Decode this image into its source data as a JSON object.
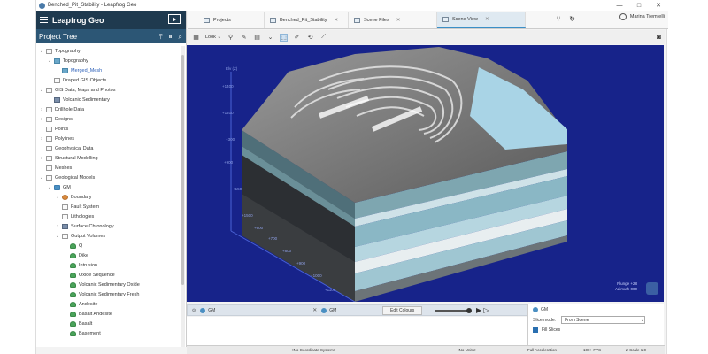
{
  "window": {
    "title": "Benched_Pit_Stability - Leapfrog Geo",
    "controls": [
      "—",
      "□",
      "✕"
    ]
  },
  "sidebar": {
    "brand": "Leapfrog Geo",
    "panel_title": "Project Tree",
    "tree": [
      {
        "label": "Topography",
        "depth": 0,
        "expander": "open",
        "icon": "folder-icon"
      },
      {
        "label": "Topography",
        "depth": 1,
        "expander": "open",
        "icon": "topography-icon"
      },
      {
        "label": "Merged_Mesh",
        "depth": 2,
        "expander": "",
        "icon": "mesh-icon",
        "selected": true
      },
      {
        "label": "Draped GIS Objects",
        "depth": 1,
        "expander": "",
        "icon": "folder-icon"
      },
      {
        "label": "GIS Data, Maps and Photos",
        "depth": 0,
        "expander": "open",
        "icon": "folder-icon"
      },
      {
        "label": "Volcanic Sedimentary",
        "depth": 1,
        "expander": "",
        "icon": "map-icon"
      },
      {
        "label": "Drillhole Data",
        "depth": 0,
        "expander": "closed",
        "icon": "folder-icon"
      },
      {
        "label": "Designs",
        "depth": 0,
        "expander": "closed",
        "icon": "folder-icon"
      },
      {
        "label": "Points",
        "depth": 0,
        "expander": "",
        "icon": "folder-icon"
      },
      {
        "label": "Polylines",
        "depth": 0,
        "expander": "closed",
        "icon": "folder-icon"
      },
      {
        "label": "Geophysical Data",
        "depth": 0,
        "expander": "",
        "icon": "folder-icon"
      },
      {
        "label": "Structural Modelling",
        "depth": 0,
        "expander": "closed",
        "icon": "folder-icon"
      },
      {
        "label": "Meshes",
        "depth": 0,
        "expander": "",
        "icon": "folder-icon"
      },
      {
        "label": "Geological Models",
        "depth": 0,
        "expander": "open",
        "icon": "folder-icon"
      },
      {
        "label": "GM",
        "depth": 1,
        "expander": "open",
        "icon": "geological-model-icon"
      },
      {
        "label": "Boundary",
        "depth": 2,
        "expander": "closed",
        "icon": "boundary-icon"
      },
      {
        "label": "Fault System",
        "depth": 2,
        "expander": "",
        "icon": "folder-icon"
      },
      {
        "label": "Lithologies",
        "depth": 2,
        "expander": "",
        "icon": "folder-icon"
      },
      {
        "label": "Surface Chronology",
        "depth": 2,
        "expander": "closed",
        "icon": "chronology-icon"
      },
      {
        "label": "Output Volumes",
        "depth": 2,
        "expander": "open",
        "icon": "folder-icon"
      },
      {
        "label": "Q",
        "depth": 3,
        "expander": "",
        "icon": "volume-icon"
      },
      {
        "label": "Dike",
        "depth": 3,
        "expander": "",
        "icon": "volume-icon"
      },
      {
        "label": "Intrusion",
        "depth": 3,
        "expander": "",
        "icon": "volume-icon"
      },
      {
        "label": "Oxide Sequence",
        "depth": 3,
        "expander": "",
        "icon": "volume-icon"
      },
      {
        "label": "Volcanic Sedimentary Oxide",
        "depth": 3,
        "expander": "",
        "icon": "volume-icon"
      },
      {
        "label": "Volcanic Sedimentary Fresh",
        "depth": 3,
        "expander": "",
        "icon": "volume-icon"
      },
      {
        "label": "Andesite",
        "depth": 3,
        "expander": "",
        "icon": "volume-icon"
      },
      {
        "label": "Basalt Andesite",
        "depth": 3,
        "expander": "",
        "icon": "volume-icon"
      },
      {
        "label": "Basalt",
        "depth": 3,
        "expander": "",
        "icon": "volume-icon"
      },
      {
        "label": "Basement",
        "depth": 3,
        "expander": "",
        "icon": "volume-icon"
      }
    ]
  },
  "tabs": [
    {
      "label": "Projects",
      "active": false,
      "closable": false
    },
    {
      "label": "Benched_Pit_Stability",
      "active": false,
      "closable": true
    },
    {
      "label": "Scene Files",
      "active": false,
      "closable": true
    },
    {
      "label": "Scene View",
      "active": true,
      "closable": true
    }
  ],
  "user": {
    "name": "Marina Tremtelli"
  },
  "toolbar": {
    "look_label": "Look"
  },
  "viewport": {
    "axis_labels": [
      "Elv (Z)",
      "+1400",
      "+1400",
      "+900",
      "+300",
      "+150",
      "+1500",
      "+600",
      "+700",
      "+800",
      "+900",
      "+1000",
      "+1100"
    ],
    "plunge_text": "Plunge +28",
    "azimuth_text": "Azimuth 000"
  },
  "shape_list": {
    "left_item": "GM",
    "right_item": "GM",
    "edit_colours": "Edit Colours"
  },
  "slice_panel": {
    "object": "GM",
    "mode_label": "Slice mode:",
    "mode_value": "From Scene",
    "fill_slices": "Fill Slices"
  },
  "statusbar": {
    "coordinate_system": "<No Coordinate System>",
    "units": "<No Units>",
    "acceleration": "Full Acceleration",
    "fps": "100+ FPS",
    "zscale": "Z-Scale 1.0"
  },
  "colors": {
    "brand_bar": "#1f3a4f",
    "tree_header": "#2c5675",
    "viewport_bg": "#17238a",
    "active_tab": "#dfe9f1"
  }
}
